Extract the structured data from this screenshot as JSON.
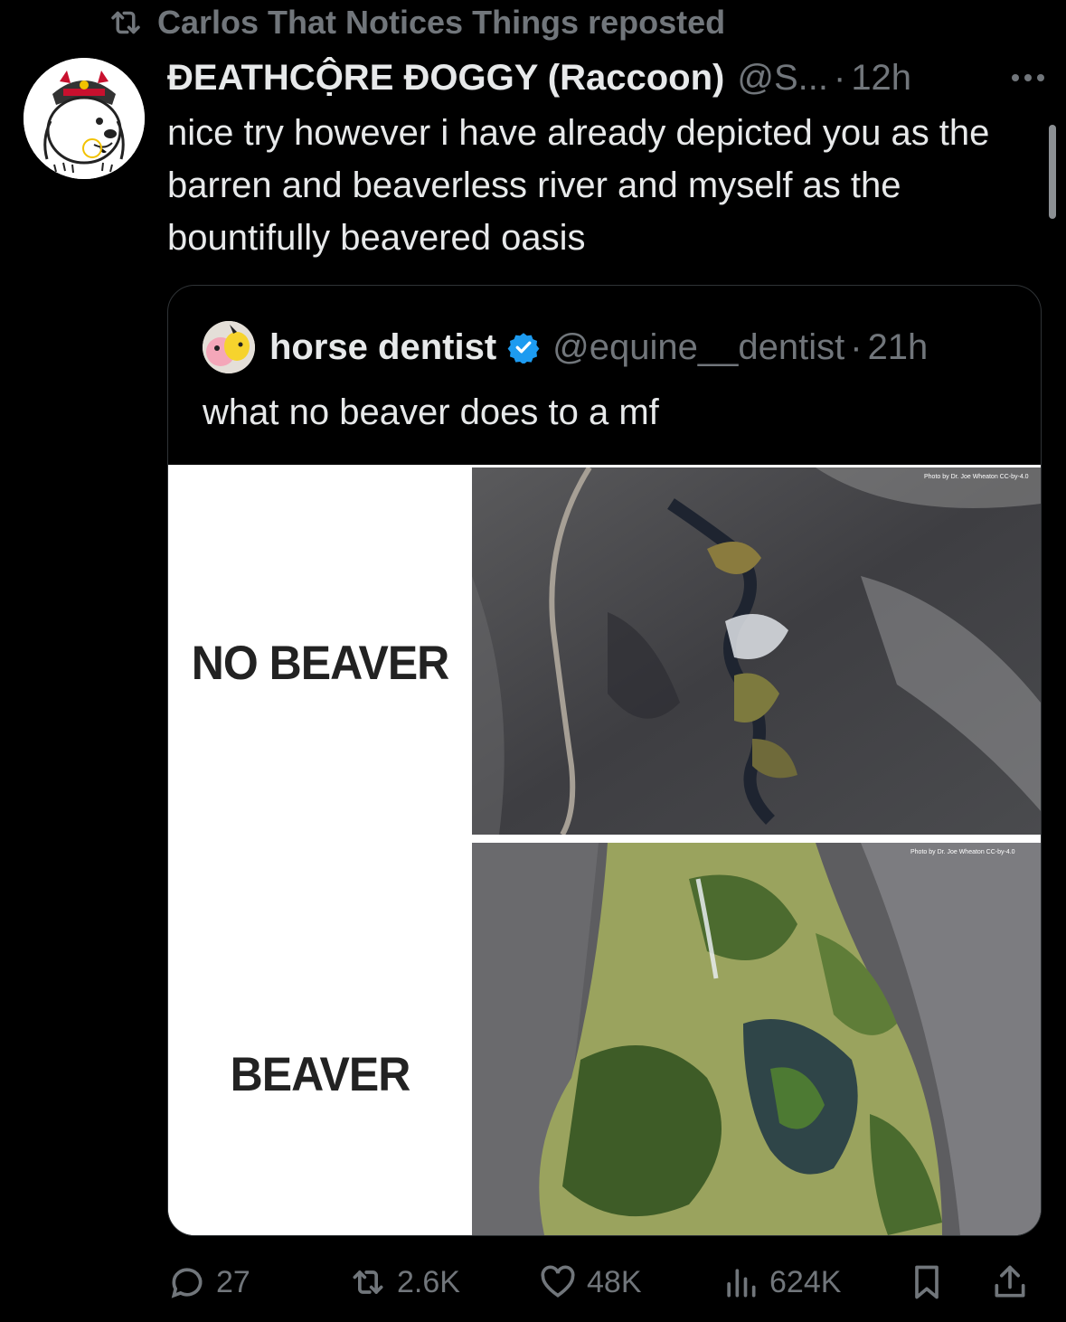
{
  "repost": {
    "text": "Carlos That Notices Things reposted",
    "icon": "repost-icon"
  },
  "post": {
    "display_name": "ĐEATHCỘRE ĐOGGY (Raccoon)",
    "handle": "@S...",
    "separator": "·",
    "time": "12h",
    "text": "nice try however i have already depicted you as the barren and beaverless river and myself as the bountifully beavered oasis",
    "avatar": "dog-avatar-icon"
  },
  "quote": {
    "name": "horse dentist",
    "verified": "verified-badge-icon",
    "handle": "@equine__dentist",
    "separator": "·",
    "time": "21h",
    "text": "what no beaver does to a mf",
    "meme": {
      "label_top": "NO BEAVER",
      "label_bottom": "BEAVER",
      "credit_top": "Photo by Dr. Joe Wheaton CC-by-4.0",
      "credit_bottom": "Photo by Dr. Joe Wheaton CC-by-4.0"
    }
  },
  "actions": {
    "replies": "27",
    "reposts": "2.6K",
    "likes": "48K",
    "views": "624K"
  },
  "colors": {
    "background": "#000000",
    "text": "#e7e9ea",
    "muted": "#71767b",
    "border": "#2f3336",
    "verified": "#1d9bf0"
  }
}
